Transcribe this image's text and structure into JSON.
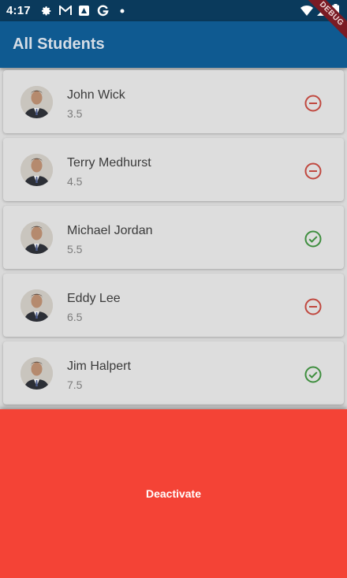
{
  "status_bar": {
    "time": "4:17",
    "icons": [
      "gear-icon",
      "gmail-icon",
      "photos-icon",
      "google-icon",
      "dot-icon"
    ],
    "right_icons": [
      "wifi-icon",
      "signal-icon",
      "battery-icon"
    ]
  },
  "debug_banner": "DEBUG",
  "app_bar": {
    "title": "All Students"
  },
  "students": [
    {
      "name": "John Wick",
      "gpa": "3.5",
      "status": "inactive",
      "status_icon": "remove-circle-icon"
    },
    {
      "name": "Terry Medhurst",
      "gpa": "4.5",
      "status": "inactive",
      "status_icon": "remove-circle-icon"
    },
    {
      "name": "Michael Jordan",
      "gpa": "5.5",
      "status": "active",
      "status_icon": "check-circle-icon"
    },
    {
      "name": "Eddy Lee",
      "gpa": "6.5",
      "status": "inactive",
      "status_icon": "remove-circle-icon"
    },
    {
      "name": "Jim Halpert",
      "gpa": "7.5",
      "status": "active",
      "status_icon": "check-circle-icon"
    }
  ],
  "bottom_panel": {
    "label": "Deactivate"
  },
  "colors": {
    "app_bar": "#0f5a91",
    "status_bar": "#0a3a5c",
    "inactive": "#c0483f",
    "active": "#3e8e3e",
    "panel": "#f44336"
  }
}
